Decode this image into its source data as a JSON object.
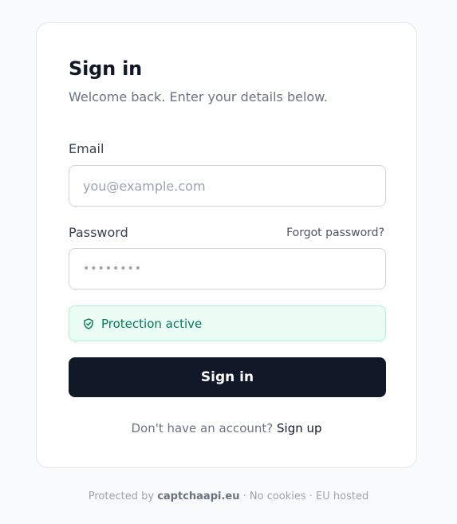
{
  "signin": {
    "title": "Sign in",
    "subtitle": "Welcome back. Enter your details below."
  },
  "email": {
    "label": "Email",
    "placeholder": "you@example.com"
  },
  "password": {
    "label": "Password",
    "forgot_label": "Forgot password?",
    "value": "••••••••"
  },
  "protection": {
    "text": "Protection active",
    "icon": "shield-check-icon"
  },
  "submit": {
    "label": "Sign in"
  },
  "signup": {
    "prompt": "Don't have an account? ",
    "link_label": "Sign up"
  },
  "footer": {
    "prefix": "Protected by ",
    "brand": "captchaapi.eu",
    "suffix": " · No cookies · EU hosted"
  }
}
